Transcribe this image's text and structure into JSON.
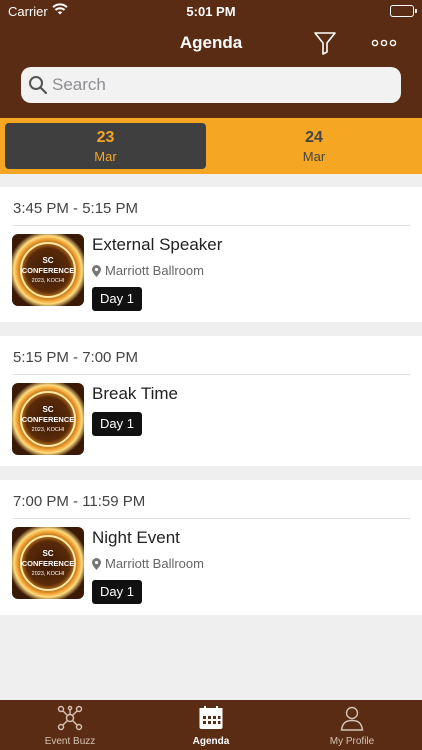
{
  "status_bar": {
    "carrier": "Carrier",
    "time": "5:01 PM"
  },
  "header": {
    "title": "Agenda"
  },
  "search": {
    "placeholder": "Search"
  },
  "dates": [
    {
      "day": "23",
      "month": "Mar",
      "selected": true
    },
    {
      "day": "24",
      "month": "Mar",
      "selected": false
    }
  ],
  "sessions": [
    {
      "time": "3:45 PM - 5:15 PM",
      "title": "External Speaker",
      "location": "Marriott Ballroom",
      "badge": "Day 1",
      "thumb_text": [
        "SC",
        "CONFERENCE",
        "2023, KOCHI"
      ]
    },
    {
      "time": "5:15 PM - 7:00 PM",
      "title": "Break Time",
      "location": "",
      "badge": "Day 1",
      "thumb_text": [
        "SC",
        "CONFERENCE",
        "2023, KOCHI"
      ]
    },
    {
      "time": "7:00 PM - 11:59 PM",
      "title": "Night Event",
      "location": "Marriott Ballroom",
      "badge": "Day 1",
      "thumb_text": [
        "SC",
        "CONFERENCE",
        "2023, KOCHI"
      ]
    }
  ],
  "tabs": [
    {
      "label": "Event Buzz",
      "icon": "network-icon",
      "active": false
    },
    {
      "label": "Agenda",
      "icon": "calendar-icon",
      "active": true
    },
    {
      "label": "My Profile",
      "icon": "profile-icon",
      "active": false
    }
  ],
  "colors": {
    "header": "#5a2c14",
    "accent": "#f5a623",
    "selected_tab": "#3f3f3f"
  }
}
